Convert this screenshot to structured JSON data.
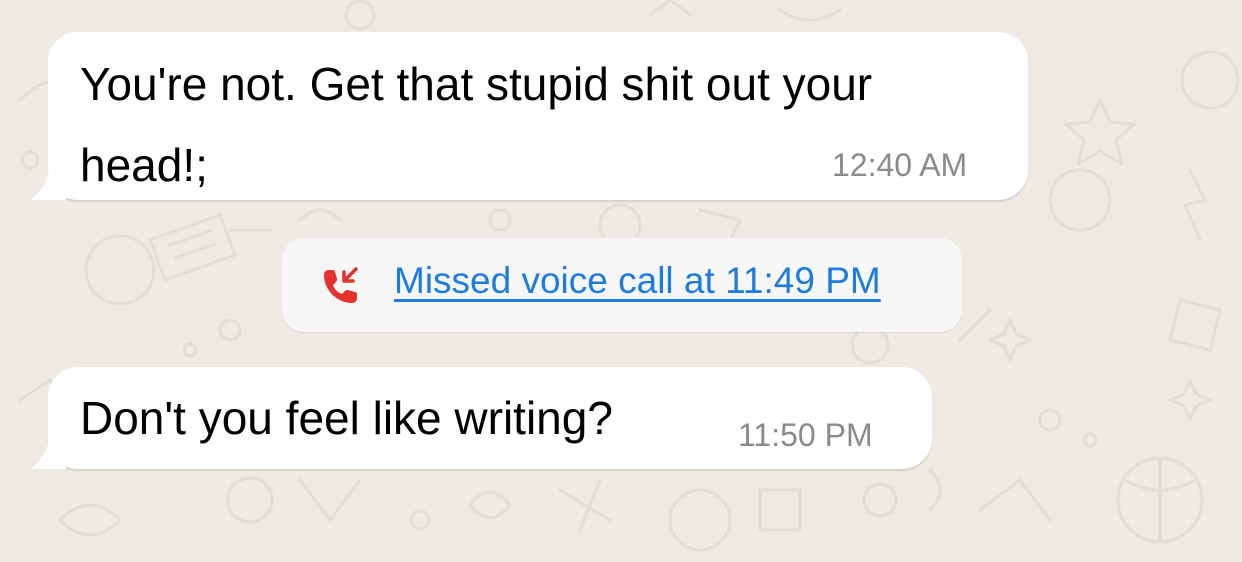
{
  "chat": {
    "messages": [
      {
        "text_lines": [
          "You're not. Get that stupid shit out your",
          "head!;"
        ],
        "time": "12:40 AM"
      },
      {
        "text": "Don't you feel like writing?",
        "time": "11:50 PM"
      }
    ],
    "missed_call": {
      "label": "Missed voice call at 11:49 PM",
      "icon": "missed-call-icon"
    }
  },
  "colors": {
    "wallpaper": "#efeae2",
    "bubble": "#ffffff",
    "link": "#1e7be0",
    "missed_call_icon": "#e5322d",
    "timestamp": "#8a8a8a"
  }
}
